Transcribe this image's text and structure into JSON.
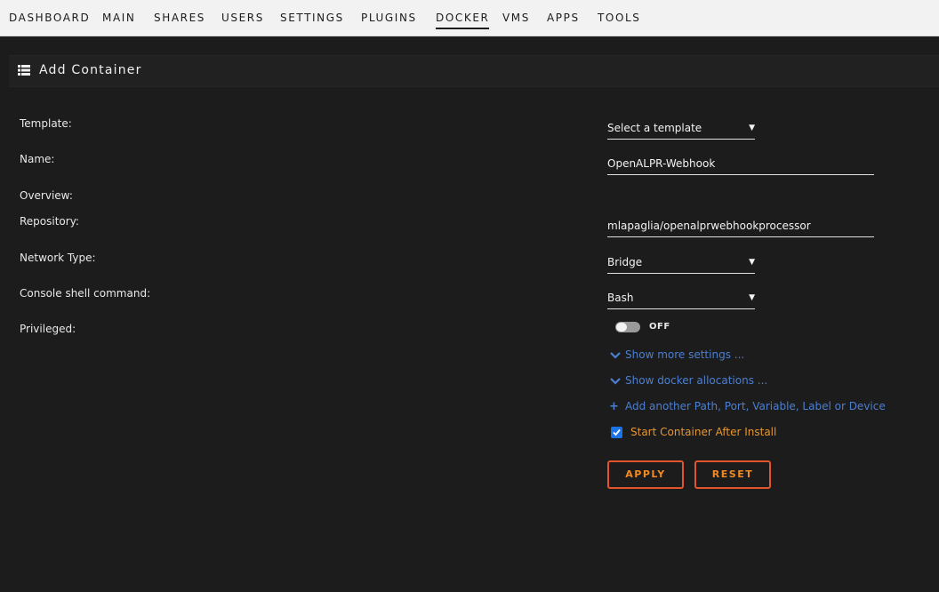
{
  "nav": {
    "items": [
      "DASHBOARD",
      "MAIN",
      "SHARES",
      "USERS",
      "SETTINGS",
      "PLUGINS",
      "DOCKER",
      "VMS",
      "APPS",
      "TOOLS"
    ],
    "active": "DOCKER"
  },
  "section": {
    "title": "Add Container",
    "icon": "grid-icon"
  },
  "form": {
    "template": {
      "label": "Template:",
      "value": "Select a template"
    },
    "name": {
      "label": "Name:",
      "value": "OpenALPR-Webhook"
    },
    "overview": {
      "label": "Overview:"
    },
    "repository": {
      "label": "Repository:",
      "value": "mlapaglia/openalprwebhookprocessor"
    },
    "network_type": {
      "label": "Network Type:",
      "value": "Bridge"
    },
    "console_shell": {
      "label": "Console shell command:",
      "value": "Bash"
    },
    "privileged": {
      "label": "Privileged:",
      "state": "OFF",
      "enabled": false
    }
  },
  "links": {
    "show_more": "Show more settings ...",
    "show_docker": "Show docker allocations ...",
    "add_another": "Add another Path, Port, Variable, Label or Device"
  },
  "start_after_install": {
    "label": "Start Container After Install",
    "checked": true
  },
  "buttons": {
    "apply": "APPLY",
    "reset": "RESET"
  },
  "colors": {
    "background": "#1c1c1c",
    "nav_background": "#f2f2f2",
    "link": "#4c7fd0",
    "accent_orange": "#f08a24",
    "button_border": "#e2542c",
    "checkbox": "#1a73e8"
  }
}
